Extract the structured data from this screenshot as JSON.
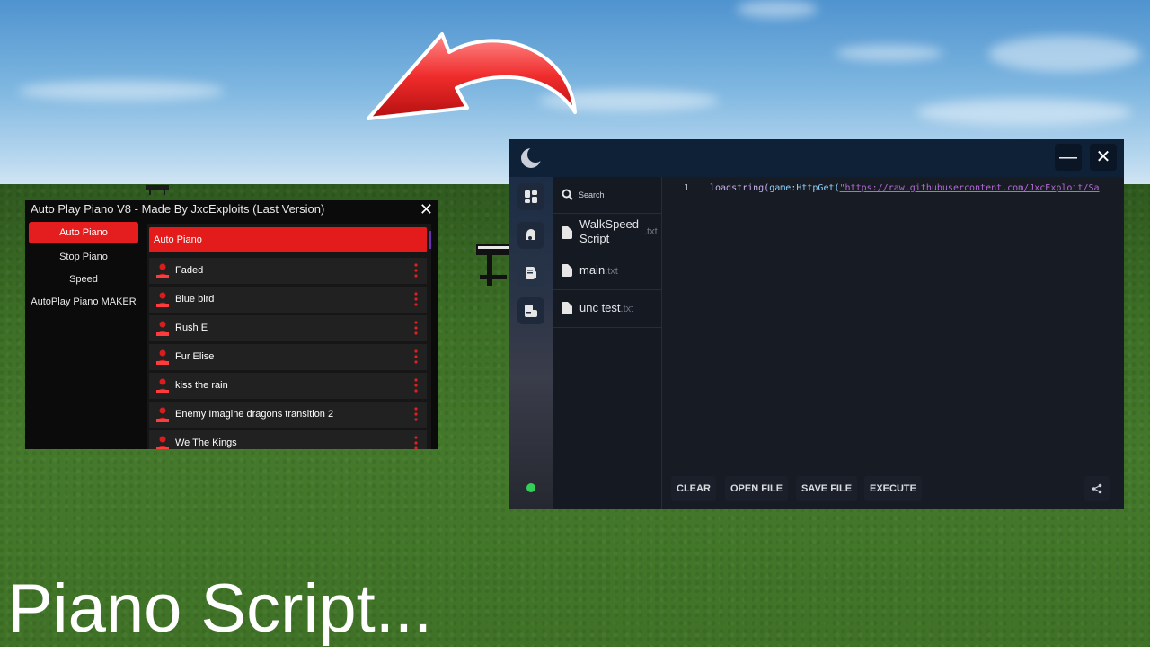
{
  "piano_window": {
    "title": "Auto Play Piano V8 - Made By JxcExploits (Last Version)",
    "close": "✕",
    "sidebar": [
      {
        "label": "Auto Piano",
        "active": true
      },
      {
        "label": "Stop Piano",
        "active": false
      },
      {
        "label": "Speed",
        "active": false
      },
      {
        "label": "AutoPlay Piano MAKER",
        "active": false
      }
    ],
    "list_header": "Auto Piano",
    "songs": [
      {
        "label": "Faded"
      },
      {
        "label": "Blue bird"
      },
      {
        "label": "Rush E"
      },
      {
        "label": "Fur Elise"
      },
      {
        "label": "kiss the rain"
      },
      {
        "label": "Enemy Imagine dragons transition 2"
      },
      {
        "label": "We The Kings"
      }
    ],
    "colors": {
      "accent": "#e31b1b",
      "scroll": "#6b2fb0"
    }
  },
  "executor": {
    "minimize": "—",
    "close": "✕",
    "search_label": "Search",
    "files": [
      {
        "name": "WalkSpeed Script",
        "name_line1": "WalkSpeed",
        "name_line2": "Script",
        "ext": ".txt"
      },
      {
        "name": "main",
        "ext": ".txt"
      },
      {
        "name": "unc test",
        "ext": ".txt"
      }
    ],
    "editor": {
      "line_number": "1",
      "code_fn": "loadstring(",
      "code_obj": "game:HttpGet(",
      "code_str": "\"https://raw.githubusercontent.com/JxcExploit/Sa"
    },
    "buttons": {
      "clear": "CLEAR",
      "open": "OPEN FILE",
      "save": "SAVE FILE",
      "execute": "EXECUTE"
    },
    "status_color": "#33d058"
  },
  "caption": "Piano Script..."
}
